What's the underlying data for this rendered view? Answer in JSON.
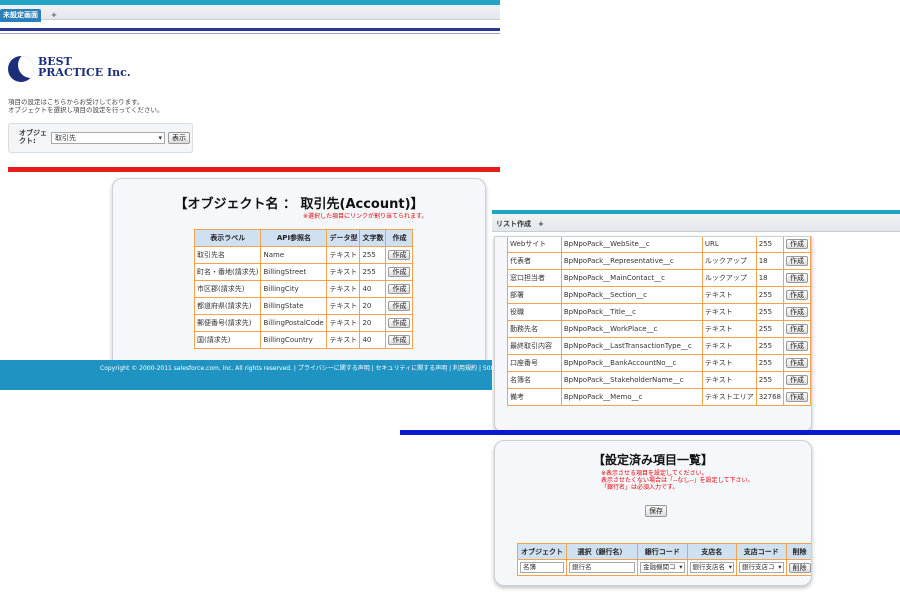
{
  "screen1": {
    "tabs": [
      "未設定画面",
      "+"
    ],
    "logo": {
      "line1": "BEST",
      "line2": "PRACTICE Inc."
    },
    "intro": [
      "項目の設定はこちらからお受けしております。",
      "オブジェクトを選択し項目の設定を行ってください。"
    ],
    "object_label": "オブジェクト:",
    "object_select": "取引先",
    "show_button": "表示",
    "card_title": "【オブジェクト名 ： 取引先(Account)】",
    "card_note": "※選択した項目にリンクが割り当てられます。",
    "columns": [
      "表示ラベル",
      "API参照名",
      "データ型",
      "文字数",
      "作成"
    ],
    "rows": [
      [
        "取引先名",
        "Name",
        "テキスト",
        "255",
        "作成"
      ],
      [
        "町名・番地(請求先)",
        "BillingStreet",
        "テキスト",
        "255",
        "作成"
      ],
      [
        "市区郡(請求先)",
        "BillingCity",
        "テキスト",
        "40",
        "作成"
      ],
      [
        "都道府県(請求先)",
        "BillingState",
        "テキスト",
        "20",
        "作成"
      ],
      [
        "郵便番号(請求先)",
        "BillingPostalCode",
        "テキスト",
        "20",
        "作成"
      ],
      [
        "国(請求先)",
        "BillingCountry",
        "テキスト",
        "40",
        "作成"
      ]
    ],
    "footer": "Copyright © 2000-2011 salesforce.com, inc. All rights reserved. | プライバシーに関する声明 | セキュリティに関する声明 | 利用規約 | 508 準"
  },
  "screen2": {
    "tabs": [
      "リスト作成",
      "+"
    ],
    "rows": [
      [
        "Webサイト",
        "BpNpoPack__WebSite__c",
        "URL",
        "255",
        "作成"
      ],
      [
        "代表者",
        "BpNpoPack__Representative__c",
        "ルックアップ",
        "18",
        "作成"
      ],
      [
        "窓口担当者",
        "BpNpoPack__MainContact__c",
        "ルックアップ",
        "18",
        "作成"
      ],
      [
        "部署",
        "BpNpoPack__Section__c",
        "テキスト",
        "255",
        "作成"
      ],
      [
        "役職",
        "BpNpoPack__Title__c",
        "テキスト",
        "255",
        "作成"
      ],
      [
        "勤務先名",
        "BpNpoPack__WorkPlace__c",
        "テキスト",
        "255",
        "作成"
      ],
      [
        "最終取引内容",
        "BpNpoPack__LastTransactionType__c",
        "テキスト",
        "255",
        "作成"
      ],
      [
        "口座番号",
        "BpNpoPack__BankAccountNo__c",
        "テキスト",
        "255",
        "作成"
      ],
      [
        "名簿名",
        "BpNpoPack__StakeholderName__c",
        "テキスト",
        "255",
        "作成"
      ],
      [
        "備考",
        "BpNpoPack__Memo__c",
        "テキストエリア",
        "32768",
        "作成"
      ]
    ]
  },
  "screen3": {
    "title": "【設定済み項目一覧】",
    "notes": [
      "※表示させる項目を設定してください。",
      "表示させたくない場合は「--なし--」を設定して下さい。",
      "「銀行名」は必須入力です。"
    ],
    "save_button": "保存",
    "columns": [
      "オブジェクト",
      "選択（銀行名）",
      "銀行コード",
      "支店名",
      "支店コード",
      "削除"
    ],
    "row": {
      "object": "名簿",
      "bank_name": "銀行名",
      "bank_code": "金融機関コ",
      "branch_name": "銀行支店名",
      "branch_code": "銀行支店コ",
      "delete": "削除"
    }
  },
  "colors": {
    "header_blue": "#23a4c4",
    "red_divider": "#e81a1a",
    "blue_divider": "#0a18d0",
    "table_header": "#cfe0f0",
    "table_border": "#f3a34d",
    "logo_navy": "#1c2e7a"
  }
}
